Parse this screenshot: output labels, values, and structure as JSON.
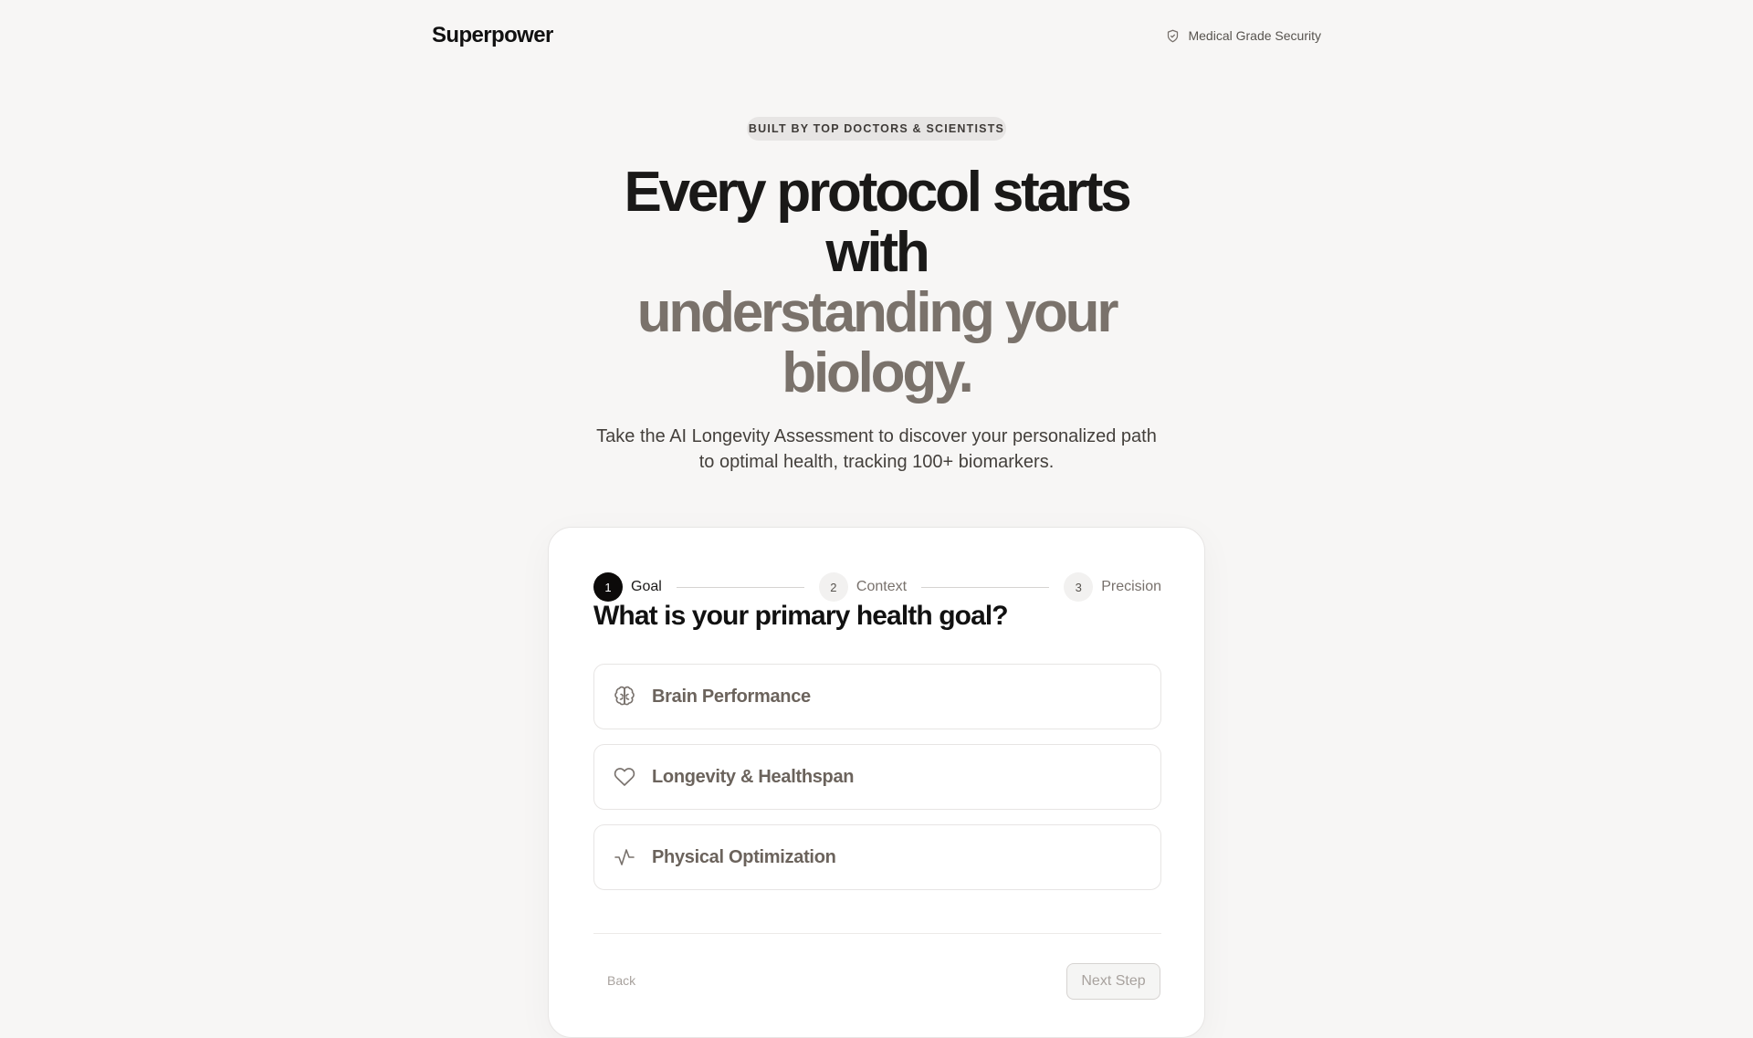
{
  "header": {
    "logo": "Superpower",
    "security_label": "Medical Grade Security"
  },
  "badge": "BUILT BY TOP DOCTORS & SCIENTISTS",
  "hero": {
    "line1": "Every protocol starts",
    "line2": "with",
    "line3": "understanding your",
    "line4": "biology."
  },
  "subtitle": {
    "line1": "Take the AI Longevity Assessment to discover your personalized path",
    "line2": "to optimal health, tracking 100+ biomarkers."
  },
  "stepper": {
    "steps": [
      {
        "num": "1",
        "label": "Goal",
        "active": true
      },
      {
        "num": "2",
        "label": "Context",
        "active": false
      },
      {
        "num": "3",
        "label": "Precision",
        "active": false
      }
    ]
  },
  "question": "What is your primary health goal?",
  "options": [
    {
      "label": "Brain Performance",
      "icon": "brain-icon"
    },
    {
      "label": "Longevity & Healthspan",
      "icon": "heart-icon"
    },
    {
      "label": "Physical Optimization",
      "icon": "activity-icon"
    }
  ],
  "footer": {
    "back_label": "Back",
    "next_label": "Next Step"
  },
  "colors": {
    "background": "#f7f6f5",
    "accent_dark": "#0c0a09",
    "muted_text": "#7a726b"
  }
}
